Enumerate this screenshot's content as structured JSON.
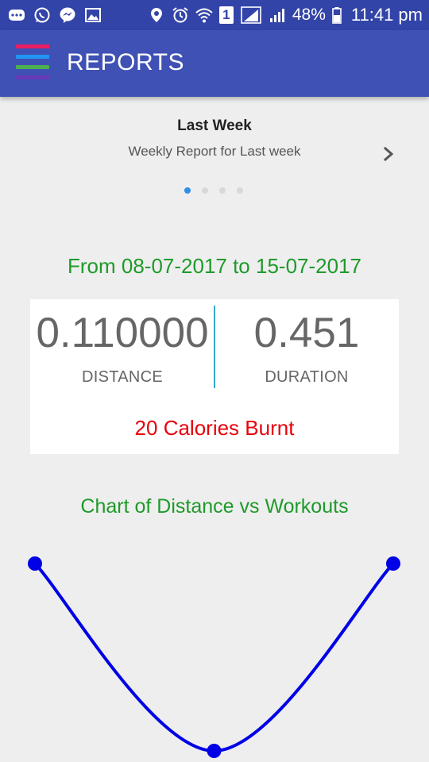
{
  "status_bar": {
    "icons": [
      "chat-icon",
      "whatsapp-icon",
      "messenger-icon",
      "gallery-icon",
      "location-icon",
      "alarm-icon",
      "wifi-icon",
      "sim-icon",
      "signal-icon",
      "signal-icon"
    ],
    "sim_label": "1",
    "battery": "48%",
    "time": "11:41 pm"
  },
  "app_bar": {
    "title": "REPORTS",
    "menu_colors": [
      "#e91e63",
      "#2196f3",
      "#4caf50",
      "#673ab7"
    ]
  },
  "carousel": {
    "title": "Last Week",
    "subtitle": "Weekly Report for Last week",
    "page_count": 4,
    "active_page": 1
  },
  "report": {
    "date_range": "From 08-07-2017 to 15-07-2017",
    "distance_value": "0.110000",
    "distance_label": "DISTANCE",
    "duration_value": "0.451",
    "duration_label": "DURATION",
    "calories": "20 Calories Burnt"
  },
  "colors": {
    "status_bar": "#3344a8",
    "app_bar": "#3f51b5",
    "accent_green": "#1e9a2a",
    "calories_red": "#e8000a",
    "chart_line": "#0000e6",
    "divider": "#35a8cc"
  },
  "chart_title": "Chart of Distance vs Workouts",
  "chart_data": {
    "type": "line",
    "title": "Chart of Distance vs Workouts",
    "xlabel": "",
    "ylabel": "",
    "x": [
      1,
      2,
      3
    ],
    "values": [
      0.05,
      0.01,
      0.05
    ],
    "color": "#0000e6",
    "grid": false,
    "smooth": true
  }
}
